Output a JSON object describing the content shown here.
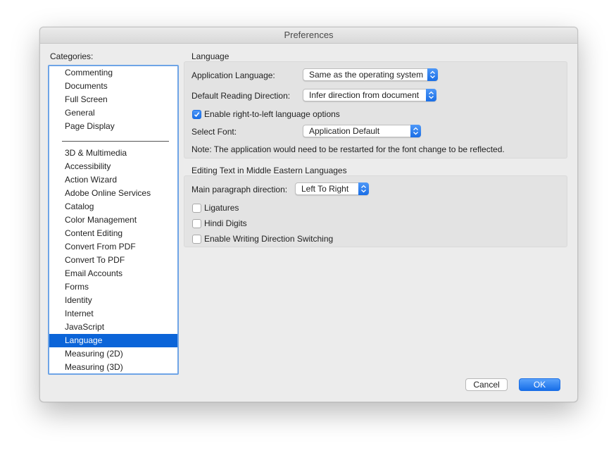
{
  "window": {
    "title": "Preferences"
  },
  "sidebar": {
    "label": "Categories:",
    "selected": "Language",
    "group1": [
      "Commenting",
      "Documents",
      "Full Screen",
      "General",
      "Page Display"
    ],
    "group2": [
      "3D & Multimedia",
      "Accessibility",
      "Action Wizard",
      "Adobe Online Services",
      "Catalog",
      "Color Management",
      "Content Editing",
      "Convert From PDF",
      "Convert To PDF",
      "Email Accounts",
      "Forms",
      "Identity",
      "Internet",
      "JavaScript",
      "Language",
      "Measuring (2D)",
      "Measuring (3D)"
    ]
  },
  "language_section": {
    "title": "Language",
    "app_language_label": "Application Language:",
    "app_language_value": "Same as the operating system",
    "reading_direction_label": "Default Reading Direction:",
    "reading_direction_value": "Infer direction from document",
    "rtl_checkbox_label": "Enable right-to-left language options",
    "rtl_checked": true,
    "font_label": "Select Font:",
    "font_value": "Application Default",
    "note": "Note: The application would need to be restarted for the font change to be reflected."
  },
  "middle_east_section": {
    "title": "Editing Text in Middle Eastern Languages",
    "paragraph_direction_label": "Main paragraph direction:",
    "paragraph_direction_value": "Left To Right",
    "ligatures_label": "Ligatures",
    "ligatures_checked": false,
    "hindi_digits_label": "Hindi Digits",
    "hindi_digits_checked": false,
    "writing_direction_label": "Enable Writing Direction Switching",
    "writing_direction_checked": false
  },
  "buttons": {
    "cancel": "Cancel",
    "ok": "OK"
  },
  "colors": {
    "accent": "#0b64d8",
    "selection": "#0b64d8",
    "window_bg": "#ececec"
  },
  "icons": {
    "popup_arrows": "up-down-chevron-icon",
    "check": "checkmark-icon"
  }
}
